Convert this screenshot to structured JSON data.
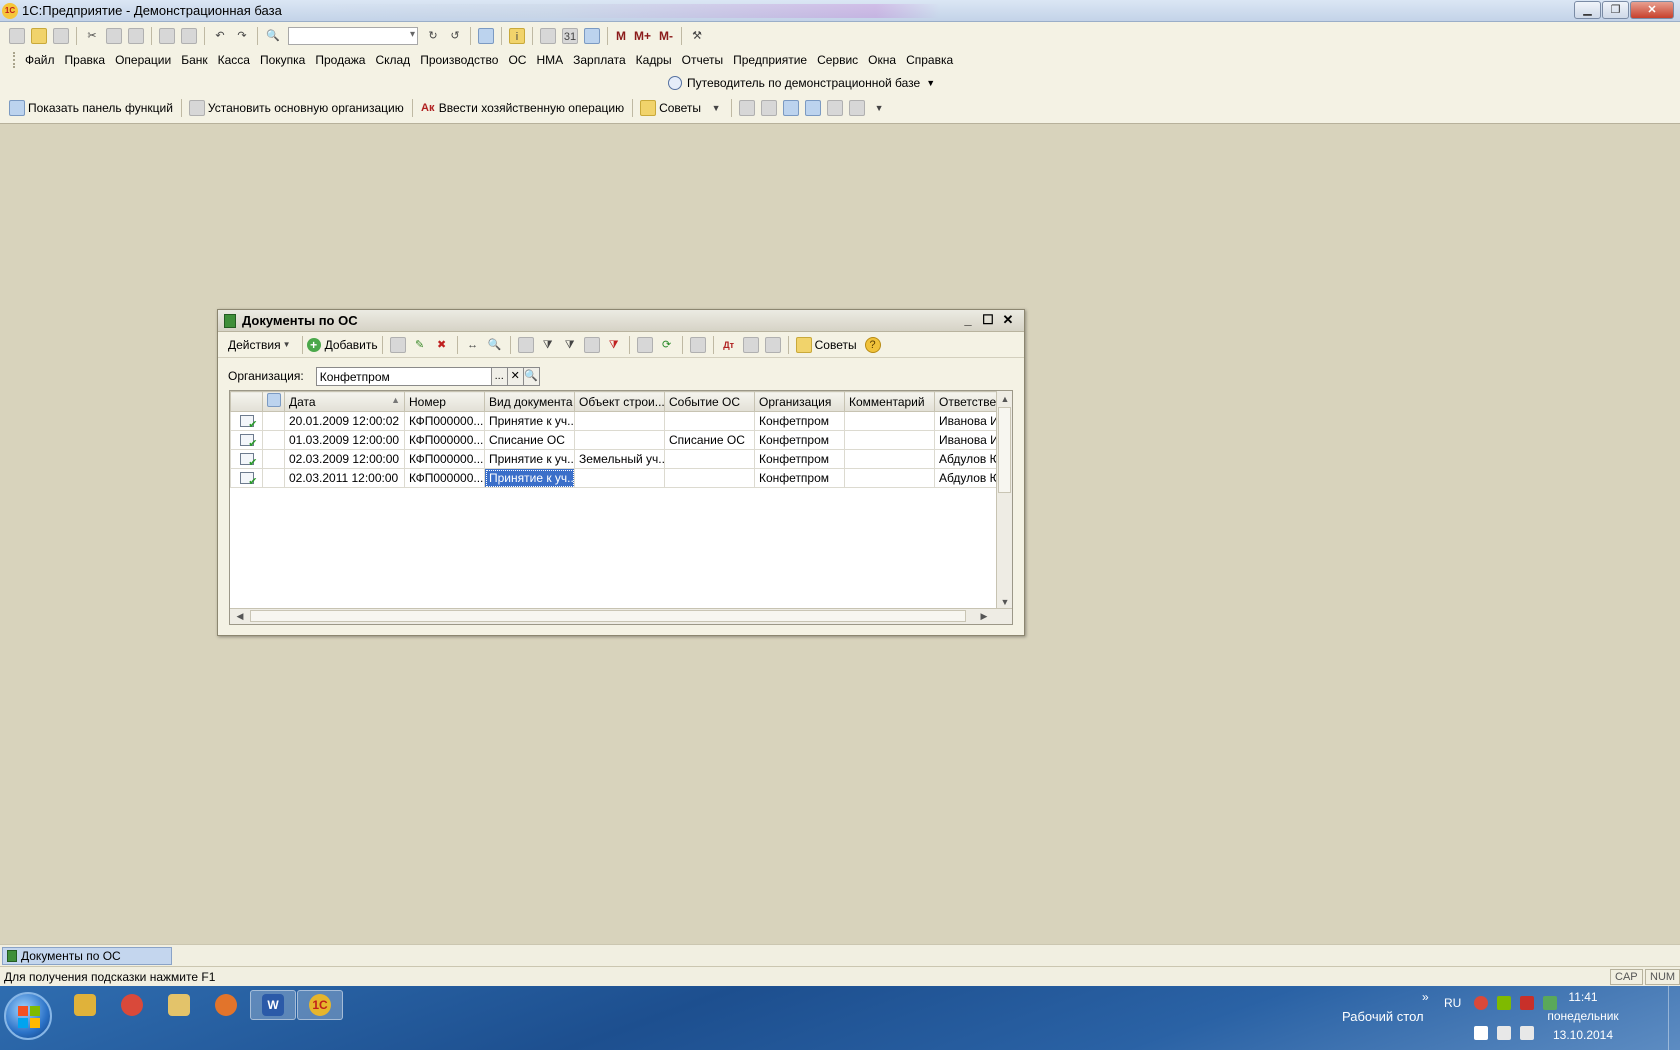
{
  "window": {
    "title": "1С:Предприятие - Демонстрационная база",
    "app_icon_text": "1С"
  },
  "toolbar": {
    "m_buttons": [
      "M",
      "M+",
      "M-"
    ]
  },
  "menu": {
    "items": [
      "Файл",
      "Правка",
      "Операции",
      "Банк",
      "Касса",
      "Покупка",
      "Продажа",
      "Склад",
      "Производство",
      "ОС",
      "НМА",
      "Зарплата",
      "Кадры",
      "Отчеты",
      "Предприятие",
      "Сервис",
      "Окна",
      "Справка"
    ]
  },
  "guide": {
    "label": "Путеводитель по демонстрационной базе"
  },
  "functions_bar": {
    "show_panel": "Показать панель функций",
    "set_org": "Установить основную организацию",
    "enter_op": "Ввести хозяйственную операцию",
    "tips": "Советы"
  },
  "doc_window": {
    "title": "Документы по ОС",
    "toolbar": {
      "actions": "Действия",
      "add": "Добавить",
      "tips": "Советы",
      "help": "?"
    },
    "org_label": "Организация:",
    "org_value": "Конфетпром",
    "org_btn_select": "...",
    "org_btn_clear": "✕",
    "columns": [
      "Дата",
      "Номер",
      "Вид документа",
      "Объект строи...",
      "Событие ОС",
      "Организация",
      "Комментарий",
      "Ответствен"
    ],
    "rows": [
      {
        "date": "20.01.2009 12:00:02",
        "number": "КФП000000...",
        "kind": "Принятие к уч...",
        "object": "",
        "event": "",
        "org": "Конфетпром",
        "comment": "",
        "resp": "Иванова Ир"
      },
      {
        "date": "01.03.2009 12:00:00",
        "number": "КФП000000...",
        "kind": "Списание ОС",
        "object": "",
        "event": "Списание ОС",
        "org": "Конфетпром",
        "comment": "",
        "resp": "Иванова Ир"
      },
      {
        "date": "02.03.2009 12:00:00",
        "number": "КФП000000...",
        "kind": "Принятие к уч...",
        "object": "Земельный уч...",
        "event": "",
        "org": "Конфетпром",
        "comment": "",
        "resp": "Абдулов Юр"
      },
      {
        "date": "02.03.2011 12:00:00",
        "number": "КФП000000...",
        "kind": "Принятие к уч...",
        "object": "",
        "event": "",
        "org": "Конфетпром",
        "comment": "",
        "resp": "Абдулов Юр"
      }
    ],
    "selected_row": 3,
    "selected_col": "kind"
  },
  "window_bar": {
    "tab": "Документы по ОС"
  },
  "status_bar": {
    "hint": "Для получения подсказки нажмите F1",
    "cap": "CAP",
    "num": "NUM"
  },
  "taskbar": {
    "apps": [
      {
        "name": "archive",
        "glyph": "",
        "color": "#e0b23a"
      },
      {
        "name": "chrome",
        "glyph": "",
        "color": "#d9493a"
      },
      {
        "name": "explorer",
        "glyph": "",
        "color": "#e3c36a"
      },
      {
        "name": "firefox",
        "glyph": "",
        "color": "#e2742b"
      },
      {
        "name": "word",
        "glyph": "W",
        "color": "#2b5aa8"
      },
      {
        "name": "1c",
        "glyph": "1С",
        "color": "#e6b52c"
      }
    ],
    "desktop_label": "Рабочий стол",
    "chevron": "»",
    "lang": "RU",
    "time": "11:41",
    "weekday": "понедельник",
    "date": "13.10.2014"
  }
}
